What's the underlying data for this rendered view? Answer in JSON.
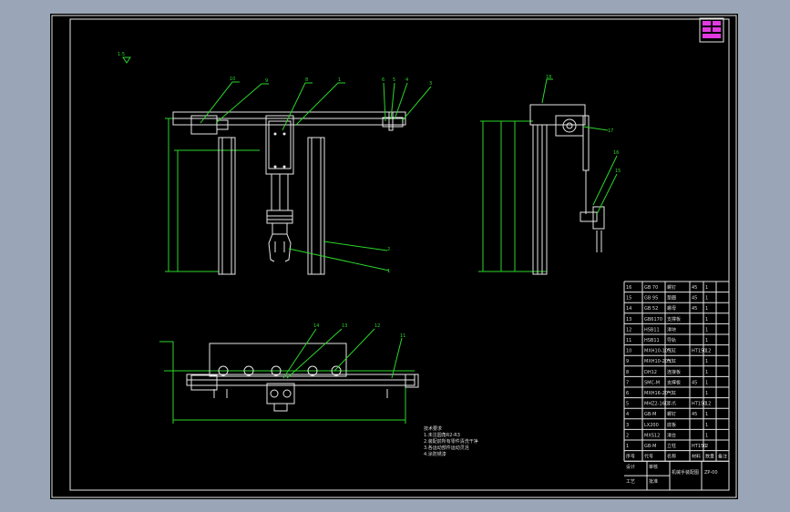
{
  "drawing": {
    "main_view_balloons": [
      "10",
      "9",
      "8",
      "1",
      "6",
      "5",
      "4",
      "3",
      "2",
      "1"
    ],
    "side_view_balloons": [
      "18",
      "17",
      "16",
      "15"
    ],
    "plan_view_balloons": [
      "14",
      "13",
      "12",
      "11"
    ],
    "scale_note": "1:5",
    "notes": [
      "技术要求",
      "1.未注圆角R2-R3",
      "2.装配前所有零件清洗干净",
      "3.各运动部件运动灵活",
      "4.涂防锈漆"
    ]
  },
  "bom": {
    "rows": [
      [
        "16",
        "GB 70",
        "螺钉",
        "45",
        "1"
      ],
      [
        "15",
        "GB 95",
        "垫圈",
        "45",
        "1"
      ],
      [
        "14",
        "GB 52",
        "螺母",
        "45",
        "1"
      ],
      [
        "13",
        "GB6170",
        "支撑板",
        "",
        "1"
      ],
      [
        "12",
        "HSB11",
        "滑块",
        "",
        "1"
      ],
      [
        "11",
        "HSB11",
        "导轨",
        "",
        "1"
      ],
      [
        "10",
        "MXH10-10S",
        "气缸",
        "HT150",
        "12"
      ],
      [
        "9",
        "MXH10-20S",
        "气缸",
        "",
        "1"
      ],
      [
        "8",
        "DH12",
        "连接板",
        "",
        "1"
      ],
      [
        "7",
        "SMC-M",
        "支撑板",
        "45",
        "1"
      ],
      [
        "6",
        "MXH16-20",
        "气缸",
        "",
        "1"
      ],
      [
        "5",
        "MHZ2-16D",
        "手爪",
        "HT150",
        "12"
      ],
      [
        "4",
        "GB-M",
        "螺钉",
        "45",
        "1"
      ],
      [
        "3",
        "LX200",
        "底板",
        "",
        "1"
      ],
      [
        "2",
        "MXS12",
        "滑台",
        "",
        "1"
      ],
      [
        "1",
        "GB-M",
        "立柱",
        "HT150",
        "2"
      ]
    ],
    "header": [
      "序号",
      "代号",
      "名称",
      "材料",
      "数量",
      "备注"
    ],
    "title_block": {
      "drawing_name": "机械手装配图",
      "code": "ZP-00",
      "labels": [
        "设计",
        "审核",
        "工艺",
        "批准"
      ]
    }
  }
}
